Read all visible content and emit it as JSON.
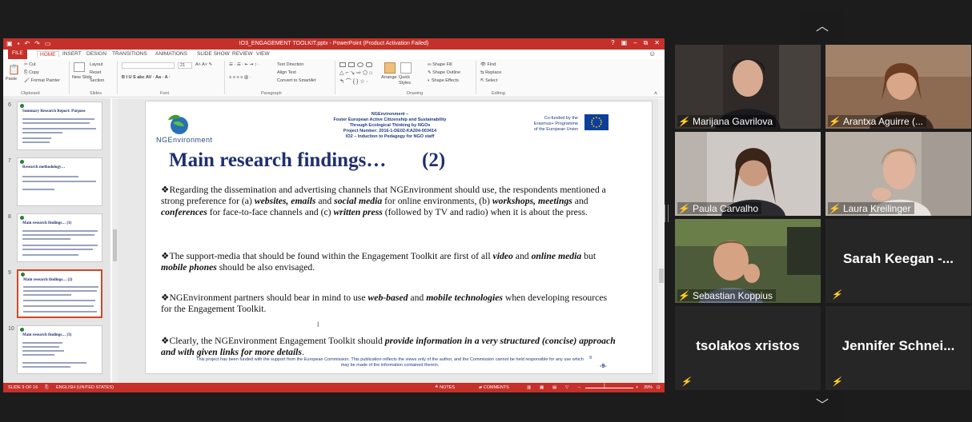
{
  "ppt": {
    "window_title": "IO3_ENGAGEMENT TOOLKIT.pptx - PowerPoint (Product Activation Failed)",
    "window_controls": [
      "?",
      "▣",
      "–",
      "⧉",
      "✕"
    ],
    "tabs": [
      "FILE",
      "HOME",
      "INSERT",
      "DESIGN",
      "TRANSITIONS",
      "ANIMATIONS",
      "SLIDE SHOW",
      "REVIEW",
      "VIEW"
    ],
    "active_tab": "HOME",
    "ribbon": {
      "cut": "Cut",
      "copy": "Copy",
      "paste": "Paste",
      "format_painter": "Format Painter",
      "new_slide": "New Slide",
      "layout": "Layout",
      "reset": "Reset",
      "section": "Section",
      "font_size": "21",
      "text_direction": "Text Direction",
      "align_text": "Align Text",
      "convert_smartart": "Convert to SmartArt",
      "arrange": "Arrange",
      "quick_styles": "Quick Styles",
      "shape_fill": "Shape Fill",
      "shape_outline": "Shape Outline",
      "shape_effects": "Shape Effects",
      "find": "Find",
      "replace": "Replace",
      "select": "Select",
      "groups": [
        "Clipboard",
        "Slides",
        "Font",
        "Paragraph",
        "Drawing",
        "Editing"
      ]
    },
    "thumbnails": [
      {
        "num": "6",
        "title": "Summary Research Report: Purpose",
        "selected": false
      },
      {
        "num": "7",
        "title": "Research methodology…",
        "selected": false
      },
      {
        "num": "8",
        "title": "Main research findings…  (1)",
        "selected": false
      },
      {
        "num": "9",
        "title": "Main research findings…  (2)",
        "selected": true
      },
      {
        "num": "10",
        "title": "Main research findings…  (3)",
        "selected": false
      }
    ],
    "slide": {
      "logo_text": "NGEnvironment",
      "header_lines": [
        "NGEnvironment –",
        "Foster European Active Citizenship and Sustainability",
        "Through Ecological Thinking by NGOs",
        "Project Number: 2016-1-DE02-KA204-003414",
        "IO2 – Induction to Pedagogy for NGO staff"
      ],
      "eu_lines": [
        "Co-funded by the",
        "Erasmus+ Programme",
        "of the European Union"
      ],
      "title": "Main research findings…",
      "title_num": "(2)",
      "bullets": [
        [
          {
            "t": "❖Regarding the dissemination and advertising channels that NGEnvironment should use, the respondents mentioned a strong preference for (a) ",
            "em": false
          },
          {
            "t": "websites, emails",
            "em": true
          },
          {
            "t": " and ",
            "em": false
          },
          {
            "t": "social media",
            "em": true
          },
          {
            "t": " for online environments, (b) ",
            "em": false
          },
          {
            "t": "workshops, meetings",
            "em": true
          },
          {
            "t": " and ",
            "em": false
          },
          {
            "t": "conferences",
            "em": true
          },
          {
            "t": " for face-to-face channels and (c) ",
            "em": false
          },
          {
            "t": "written press",
            "em": true
          },
          {
            "t": " (followed by TV and radio) when it is about the press.",
            "em": false
          }
        ],
        [
          {
            "t": "❖The support-media that should be found within the Engagement Toolkit are first of all ",
            "em": false
          },
          {
            "t": "video",
            "em": true
          },
          {
            "t": " and ",
            "em": false
          },
          {
            "t": "online media",
            "em": true
          },
          {
            "t": " but ",
            "em": false
          },
          {
            "t": "mobile phones",
            "em": true
          },
          {
            "t": " should be also envisaged.",
            "em": false
          }
        ],
        [
          {
            "t": "❖NGEnvironment partners should bear in mind to use ",
            "em": false
          },
          {
            "t": "web-based",
            "em": true
          },
          {
            "t": " and ",
            "em": false
          },
          {
            "t": "mobile technologies",
            "em": true
          },
          {
            "t": " when developing resources for the Engagement Toolkit.",
            "em": false
          }
        ],
        [
          {
            "t": "❖Clearly, the NGEnvironment Engagement Toolkit should ",
            "em": false
          },
          {
            "t": "provide information in a very structured (concise) approach and with given links for more details",
            "em": true
          },
          {
            "t": ".",
            "em": false
          }
        ]
      ],
      "footer": "This project has been funded with the support from the European Commission. This publication reflects the views only of the author, and the Commission cannot be held responsible for any use which may be made of the information contained therein.",
      "page_small": "9",
      "page_big": "-9-"
    },
    "status": {
      "slide_of": "SLIDE 9 OF 16",
      "language": "ENGLISH (UNITED STATES)",
      "notes": "NOTES",
      "comments": "COMMENTS",
      "zoom": "39%"
    }
  },
  "participants": [
    {
      "name": "Marijana Gavrilova",
      "video": true
    },
    {
      "name": "Arantxa Aguirre (...",
      "video": true
    },
    {
      "name": "Paula Carvalho",
      "video": true
    },
    {
      "name": "Laura Kreilinger",
      "video": true
    },
    {
      "name": "Sebastian Koppius",
      "video": true
    },
    {
      "name": "Sarah Keegan -...",
      "video": false
    },
    {
      "name": "tsolakos xristos",
      "video": false
    },
    {
      "name": "Jennifer Schnei...",
      "video": false
    }
  ],
  "nav": {
    "up": "︿",
    "down": "﹀"
  },
  "colors": {
    "ppt_accent": "#c6302a",
    "slide_title": "#1f2f6e",
    "mic_muted": "#e23b3b"
  }
}
